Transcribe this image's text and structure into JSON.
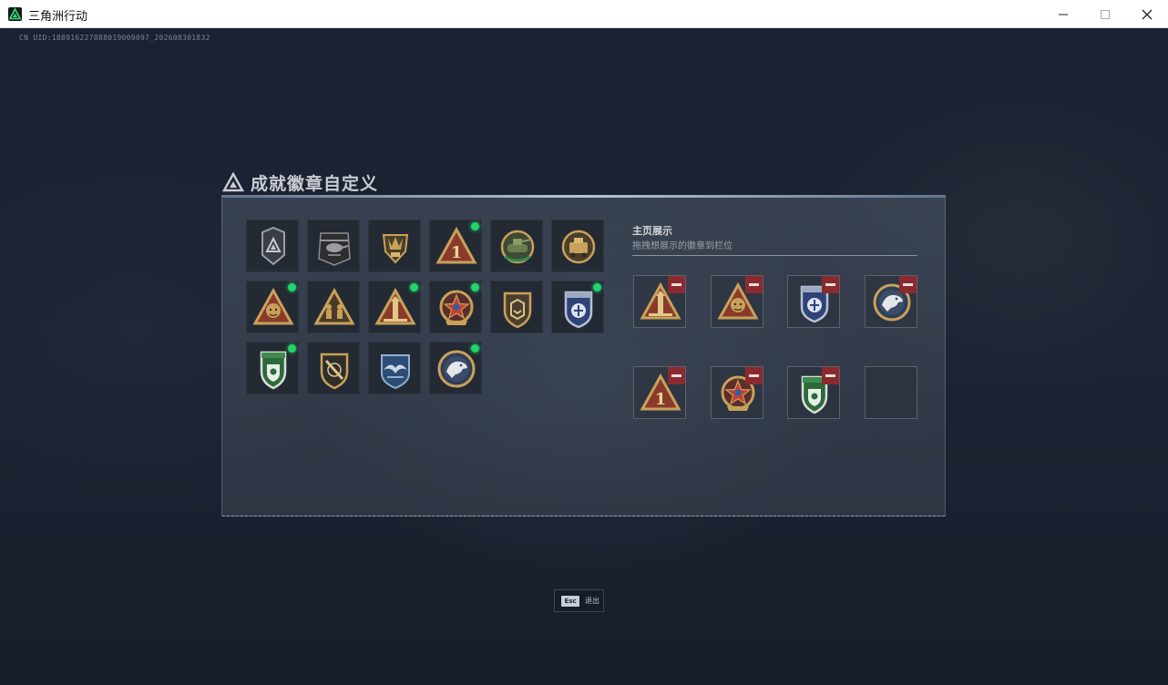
{
  "window": {
    "title": "三角洲行动"
  },
  "uid_text": "CN UID:188916227888019009097_202608301832",
  "panel": {
    "title": "成就徽章自定义"
  },
  "home_display": {
    "title": "主页展示",
    "subtitle": "拖拽想展示的徽章到栏位"
  },
  "badges": [
    {
      "icon": "delta-shield-badge-icon",
      "new": false
    },
    {
      "icon": "helicopter-badge-icon",
      "new": false
    },
    {
      "icon": "crown-crest-badge-icon",
      "new": false
    },
    {
      "icon": "number-one-triangle-badge-icon",
      "new": true
    },
    {
      "icon": "green-tank-badge-icon",
      "new": false
    },
    {
      "icon": "armored-vehicle-badge-icon",
      "new": false
    },
    {
      "icon": "lion-triangle-badge-icon",
      "new": true
    },
    {
      "icon": "soldiers-triangle-badge-icon",
      "new": false
    },
    {
      "icon": "tower-triangle-badge-icon",
      "new": true
    },
    {
      "icon": "red-star-medal-icon",
      "new": true
    },
    {
      "icon": "chevron-shield-badge-icon",
      "new": false
    },
    {
      "icon": "blue-police-badge-icon",
      "new": true
    },
    {
      "icon": "green-lion-shield-badge-icon",
      "new": true
    },
    {
      "icon": "rifle-shield-badge-icon",
      "new": false
    },
    {
      "icon": "blue-wings-badge-icon",
      "new": false
    },
    {
      "icon": "eagle-medallion-badge-icon",
      "new": true
    }
  ],
  "slots": [
    {
      "icon": "tower-triangle-badge-icon",
      "filled": true
    },
    {
      "icon": "lion-triangle-badge-icon",
      "filled": true
    },
    {
      "icon": "blue-police-badge-icon",
      "filled": true
    },
    {
      "icon": "eagle-medallion-badge-icon",
      "filled": true
    },
    {
      "icon": "number-one-triangle-badge-icon",
      "filled": true
    },
    {
      "icon": "red-star-medal-icon",
      "filled": true
    },
    {
      "icon": "green-lion-shield-badge-icon",
      "filled": true
    },
    {
      "icon": "",
      "filled": false
    }
  ],
  "esc_hint": {
    "key": "Esc",
    "label": "退出"
  },
  "colors": {
    "new_dot": "#22d46b",
    "remove_button": "#8b2a2e",
    "gold": "#c8a15a",
    "accent_blue": "#b7c4d3"
  }
}
